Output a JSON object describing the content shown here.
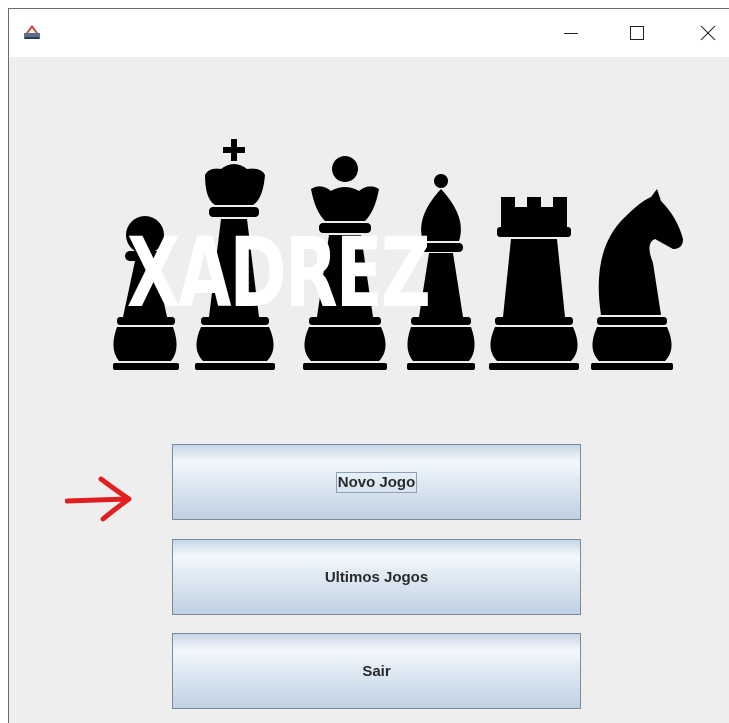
{
  "window": {
    "title": "",
    "controls": {
      "minimize": "—",
      "maximize": "☐",
      "close": "✕"
    }
  },
  "logo": {
    "title": "XADREZ"
  },
  "menu": {
    "buttons": [
      {
        "label": "Novo Jogo",
        "focused": true
      },
      {
        "label": "Ultimos Jogos",
        "focused": false
      },
      {
        "label": "Sair",
        "focused": false
      }
    ]
  },
  "annotation": {
    "icon": "red-arrow-icon",
    "color": "#e02020"
  }
}
